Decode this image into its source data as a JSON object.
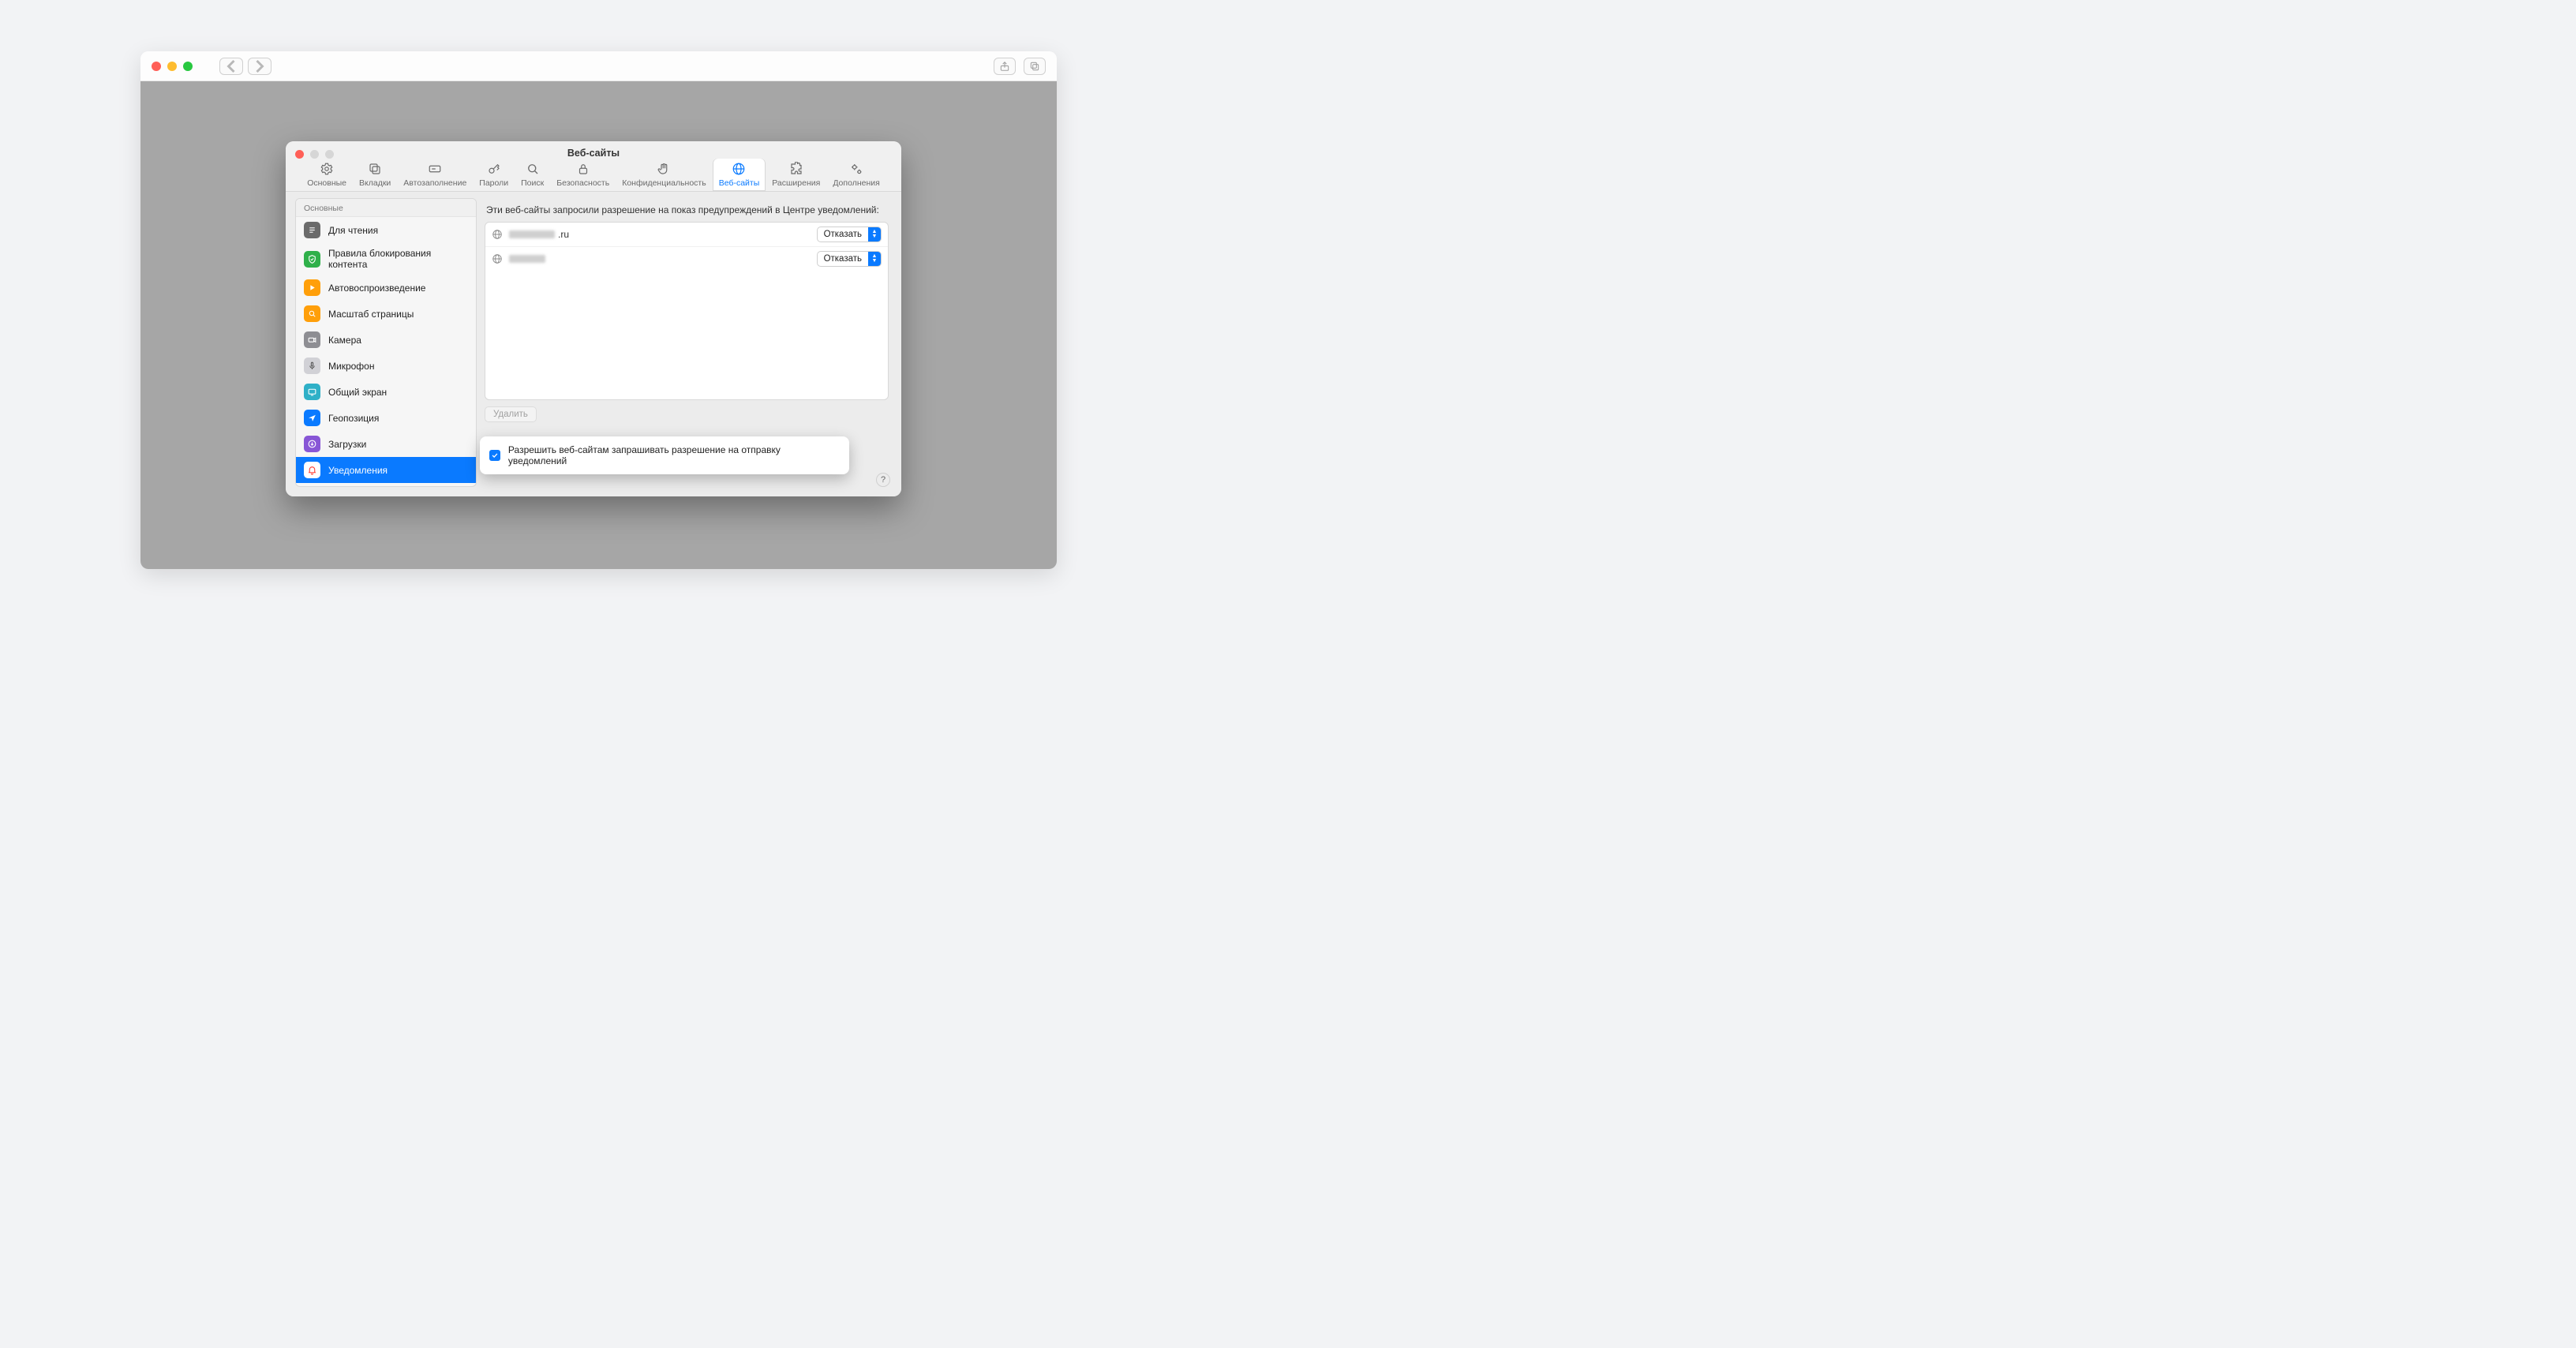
{
  "prefs": {
    "title": "Веб-сайты",
    "tabs": [
      {
        "label": "Основные"
      },
      {
        "label": "Вкладки"
      },
      {
        "label": "Автозаполнение"
      },
      {
        "label": "Пароли"
      },
      {
        "label": "Поиск"
      },
      {
        "label": "Безопасность"
      },
      {
        "label": "Конфиденциальность"
      },
      {
        "label": "Веб-сайты"
      },
      {
        "label": "Расширения"
      },
      {
        "label": "Дополнения"
      }
    ],
    "sidebar": {
      "header": "Основные",
      "items": [
        {
          "label": "Для чтения"
        },
        {
          "label": "Правила блокирования контента"
        },
        {
          "label": "Автовоспроизведение"
        },
        {
          "label": "Масштаб страницы"
        },
        {
          "label": "Камера"
        },
        {
          "label": "Микрофон"
        },
        {
          "label": "Общий экран"
        },
        {
          "label": "Геопозиция"
        },
        {
          "label": "Загрузки"
        },
        {
          "label": "Уведомления"
        }
      ]
    },
    "content": {
      "header": "Эти веб-сайты запросили разрешение на показ предупреждений в Центре уведомлений:",
      "sites": [
        {
          "suffix": ".ru",
          "permission": "Отказать"
        },
        {
          "suffix": "",
          "permission": "Отказать"
        }
      ],
      "delete_label": "Удалить",
      "allow_checkbox": "Разрешить веб-сайтам запрашивать разрешение на отправку уведомлений"
    },
    "help": "?"
  }
}
